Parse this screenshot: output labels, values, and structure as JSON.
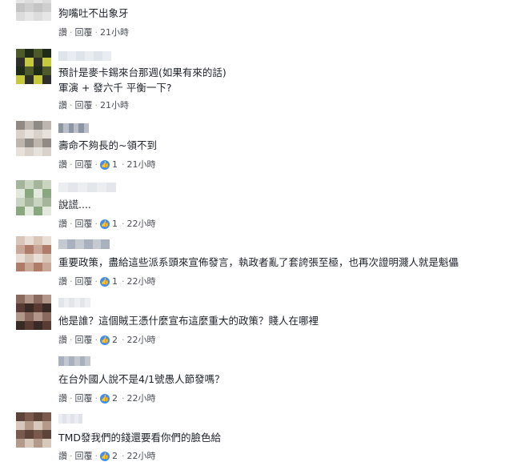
{
  "comments": [
    {
      "name": "",
      "text": "狗嘴吐不出象牙",
      "actions": {
        "like": "讚",
        "reply": "回覆"
      },
      "reaction_count": "",
      "time": "21小時",
      "avatar_palette": [
        "#cfcfcf",
        "#dcdcdc",
        "#c4c4c4",
        "#e6e6e6"
      ],
      "name_palette": []
    },
    {
      "name": "",
      "text": "預計是麥卡錫來台那週(如果有來的話)\n軍演 + 發六千 平衡一下?",
      "actions": {
        "like": "讚",
        "reply": "回覆"
      },
      "reaction_count": "",
      "time": "21小時",
      "avatar_palette": [
        "#2e2e2a",
        "#4f5a2a",
        "#c6c93b",
        "#1f2a18"
      ],
      "name_palette": [
        "#c8cdd6",
        "#dfe3ea",
        "#b7bfcc",
        "#e9ecf1"
      ]
    },
    {
      "name": "",
      "text": "壽命不夠長的~領不到",
      "actions": {
        "like": "讚",
        "reply": "回覆"
      },
      "reaction_count": "1",
      "time": "21小時",
      "avatar_palette": [
        "#bdb6ae",
        "#d8d2cb",
        "#8f8a84",
        "#e6e1db"
      ],
      "name_palette": [
        "#b9bec8",
        "#d9dde4",
        "#8d95a3",
        "#eef0f3"
      ]
    },
    {
      "name": "",
      "text": "說謊....",
      "actions": {
        "like": "讚",
        "reply": "回覆"
      },
      "reaction_count": "1",
      "time": "22小時",
      "avatar_palette": [
        "#8aa87f",
        "#c9d5c1",
        "#e3e8dd",
        "#a5b59b"
      ],
      "name_palette": [
        "#cdd2da",
        "#e3e6eb",
        "#b9c0cb",
        "#eceef2"
      ]
    },
    {
      "name": "",
      "text": "重要政策，盡給這些派系頭來宣佈發言，執政者亂了套誇張至極，也再次證明濺人就是魁儡",
      "actions": {
        "like": "讚",
        "reply": "回覆"
      },
      "reaction_count": "1",
      "time": "22小時",
      "avatar_palette": [
        "#d8c6b8",
        "#b07c6a",
        "#e8ded5",
        "#c9a898"
      ],
      "name_palette": [
        "#c4c9d2",
        "#e1e4ea",
        "#a9b1be",
        "#eaedf1"
      ]
    },
    {
      "name": "",
      "text": "他是誰？這個賊王憑什麼宣布這麼重大的政策？賤人在哪裡",
      "actions": {
        "like": "讚",
        "reply": "回覆"
      },
      "reaction_count": "2",
      "time": "22小時",
      "avatar_palette": [
        "#5a3b33",
        "#8a6a5e",
        "#3a2a26",
        "#b3968a"
      ],
      "name_palette": [
        "#c7ccd5",
        "#e2e5ea",
        "#b0b7c3",
        "#edeff3"
      ]
    },
    {
      "name": "",
      "text": "在台外國人說不是4/1號愚人節發嗎？",
      "actions": {
        "like": "讚",
        "reply": "回覆"
      },
      "reaction_count": "2",
      "time": "22小時",
      "avatar_palette": [],
      "name_palette": [
        "#c2c7d0",
        "#dfe2e8",
        "#a8b0bd",
        "#eaecf0"
      ]
    },
    {
      "name": "",
      "text": "TMD發我們的錢還要看你們的臉色給",
      "actions": {
        "like": "讚",
        "reply": "回覆"
      },
      "reaction_count": "2",
      "time": "22小時",
      "avatar_palette": [
        "#b39a8a",
        "#7a5a4c",
        "#d8c8bc",
        "#5e4438"
      ],
      "name_palette": [
        "#c6cbd4",
        "#e0e3e9",
        "#aeb5c1",
        "#ebedf1"
      ]
    }
  ]
}
